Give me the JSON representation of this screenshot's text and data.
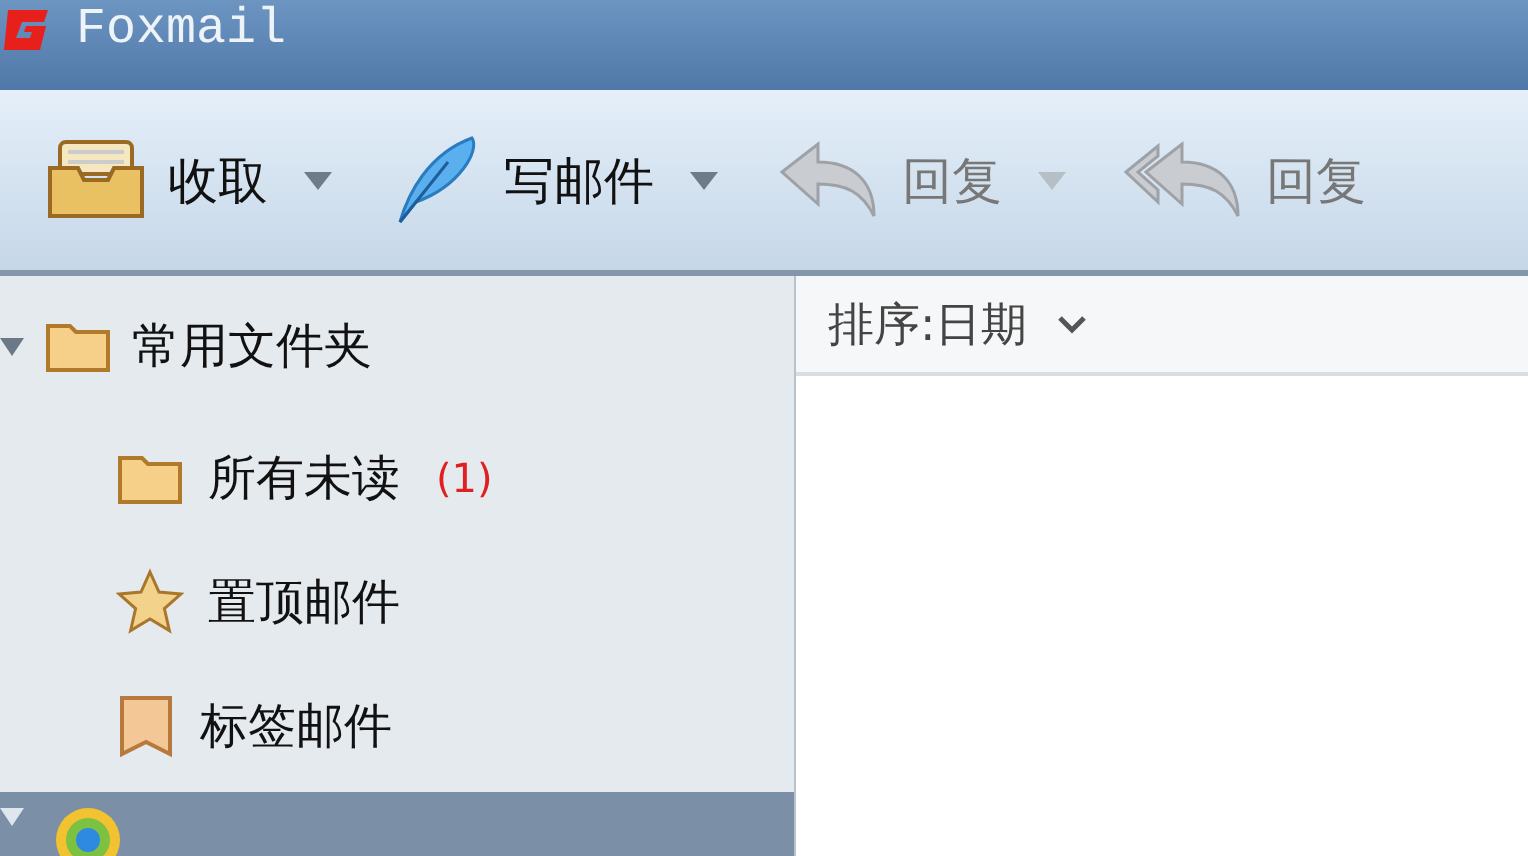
{
  "window": {
    "title": "Foxmail"
  },
  "toolbar": [
    {
      "label": "收取",
      "kind": "inbox",
      "disabled": false,
      "has_menu": true
    },
    {
      "label": "写邮件",
      "kind": "compose",
      "disabled": false,
      "has_menu": true
    },
    {
      "label": "回复",
      "kind": "reply",
      "disabled": true,
      "has_menu": true
    },
    {
      "label": "回复",
      "kind": "reply-all",
      "disabled": true,
      "has_menu": false
    }
  ],
  "sidebar": {
    "items": [
      {
        "label": "常用文件夹",
        "kind": "folder",
        "expanded": true,
        "children": [
          {
            "label": "所有未读",
            "kind": "folder",
            "count": "(1)"
          },
          {
            "label": "置顶邮件",
            "kind": "pinned"
          },
          {
            "label": "标签邮件",
            "kind": "tagged"
          }
        ]
      }
    ],
    "account": {
      "selected": true,
      "expanded": true
    }
  },
  "list": {
    "sort_label": "排序:日期"
  }
}
